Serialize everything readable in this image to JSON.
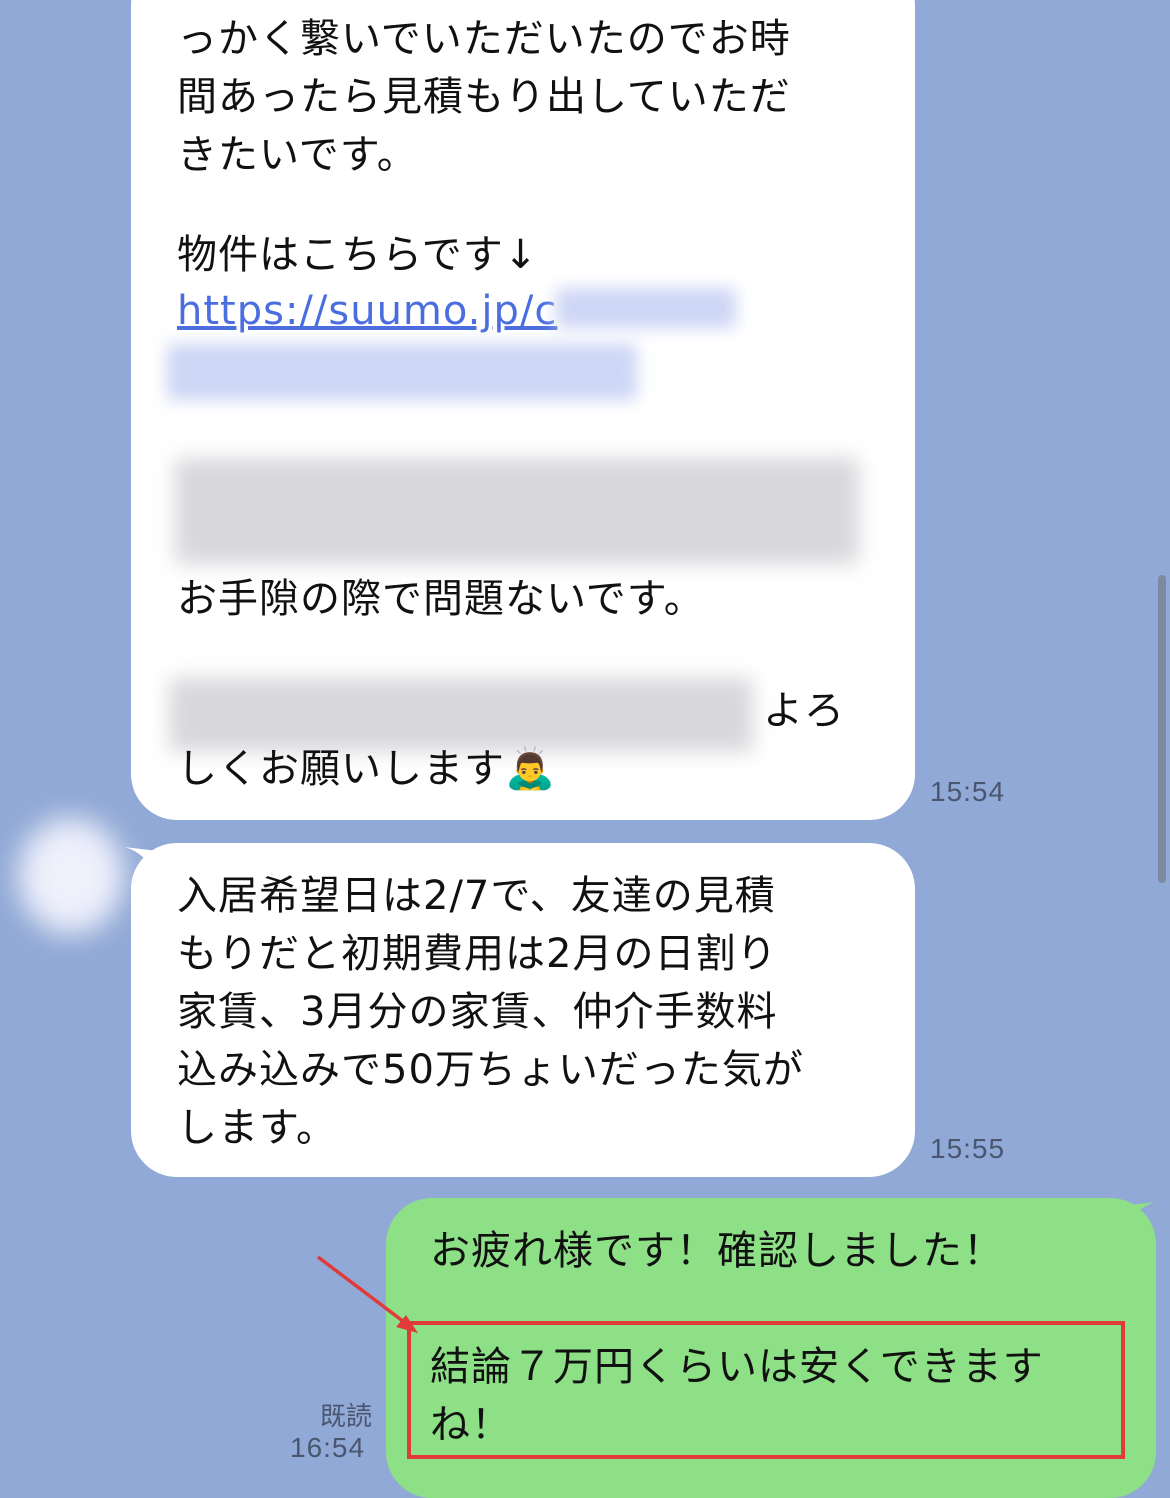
{
  "messages": {
    "msg1": {
      "lines": [
        "っかく繋いでいただいたのでお時",
        "間あったら見積もり出していただ",
        "きたいです。",
        "物件はこちらです↓",
        "お手隙の際で問題ないです。",
        "よろ",
        "しくお願いします🙇‍♂️"
      ],
      "link": "https://suumo.jp/c",
      "time": "15:54"
    },
    "msg2": {
      "lines": [
        "入居希望日は2/7で、友達の見積",
        "もりだと初期費用は2月の日割り",
        "家賃、3月分の家賃、仲介手数料",
        "込み込みで50万ちょいだった気が",
        "します。"
      ],
      "time": "15:55"
    },
    "msg3": {
      "lines": [
        "お疲れ様です！確認しました！",
        "結論７万円くらいは安くできます",
        "ね！"
      ],
      "read": "既読",
      "time": "16:54"
    }
  },
  "colors": {
    "background": "#91a9d6",
    "incoming_bubble": "#ffffff",
    "outgoing_bubble": "#8de086",
    "link": "#4a6ee0",
    "annotation": "#e03a3a"
  }
}
